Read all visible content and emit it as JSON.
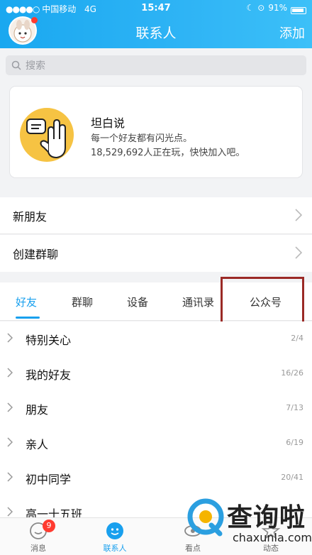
{
  "status_bar": {
    "carrier": "中国移动",
    "network": "4G",
    "time": "15:47",
    "battery": "91%"
  },
  "nav": {
    "title": "联系人",
    "add_label": "添加"
  },
  "search": {
    "placeholder": "搜索"
  },
  "promo_card": {
    "title": "坦白说",
    "subtitle": "每一个好友都有闪光点。",
    "players": "18,529,692人正在玩，快快加入吧。"
  },
  "menu": {
    "new_friends": "新朋友",
    "create_group": "创建群聊"
  },
  "tabs": [
    {
      "label": "好友",
      "active": true
    },
    {
      "label": "群聊"
    },
    {
      "label": "设备"
    },
    {
      "label": "通讯录"
    },
    {
      "label": "公众号"
    }
  ],
  "groups": [
    {
      "name": "特别关心",
      "count": "2/4"
    },
    {
      "name": "我的好友",
      "count": "16/26"
    },
    {
      "name": "朋友",
      "count": "7/13"
    },
    {
      "name": "亲人",
      "count": "6/19"
    },
    {
      "name": "初中同学",
      "count": "20/41"
    },
    {
      "name": "高一十五班",
      "count": ""
    }
  ],
  "bottom_nav": [
    {
      "label": "消息",
      "badge": "9"
    },
    {
      "label": "联系人",
      "active": true
    },
    {
      "label": "看点"
    },
    {
      "label": "动态"
    }
  ],
  "watermark": {
    "title": "查询啦",
    "url": "chaxunla.com"
  },
  "colors": {
    "accent": "#19a0ee",
    "header": "#1aa8f0",
    "badge": "#ff3b30",
    "highlight": "#9b2a26"
  }
}
